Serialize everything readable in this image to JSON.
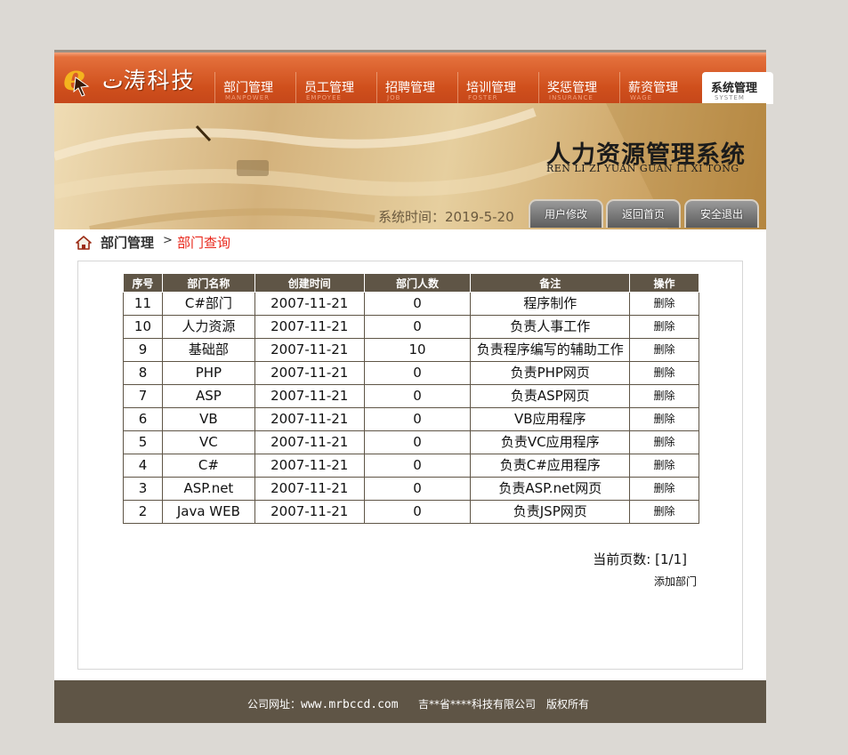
{
  "brand": {
    "name": "ت涛科技"
  },
  "nav": [
    {
      "cn": "部门管理",
      "en": "MANPOWER"
    },
    {
      "cn": "员工管理",
      "en": "EMPOYEE"
    },
    {
      "cn": "招聘管理",
      "en": "JOB"
    },
    {
      "cn": "培训管理",
      "en": "FOSTER"
    },
    {
      "cn": "奖惩管理",
      "en": "INSURANCE"
    },
    {
      "cn": "薪资管理",
      "en": "WAGE"
    },
    {
      "cn": "系统管理",
      "en": "SYSTEM"
    }
  ],
  "banner": {
    "title": "人力资源管理系统",
    "pinyin": "REN LI ZI YUAN GUAN LI XI TONG",
    "time_label": "系统时间：",
    "time_value": "2019-5-20",
    "buttons": [
      "用户修改",
      "返回首页",
      "安全退出"
    ]
  },
  "breadcrumb": {
    "section": "部门管理",
    "separator": ">",
    "page": "部门查询"
  },
  "table": {
    "headers": [
      "序号",
      "部门名称",
      "创建时间",
      "部门人数",
      "备注",
      "操作"
    ],
    "rows": [
      [
        "11",
        "C#部门",
        "2007-11-21",
        "0",
        "程序制作",
        "删除"
      ],
      [
        "10",
        "人力资源",
        "2007-11-21",
        "0",
        "负责人事工作",
        "删除"
      ],
      [
        "9",
        "基础部",
        "2007-11-21",
        "10",
        "负责程序编写的辅助工作",
        "删除"
      ],
      [
        "8",
        "PHP",
        "2007-11-21",
        "0",
        "负责PHP网页",
        "删除"
      ],
      [
        "7",
        "ASP",
        "2007-11-21",
        "0",
        "负责ASP网页",
        "删除"
      ],
      [
        "6",
        "VB",
        "2007-11-21",
        "0",
        "VB应用程序",
        "删除"
      ],
      [
        "5",
        "VC",
        "2007-11-21",
        "0",
        "负责VC应用程序",
        "删除"
      ],
      [
        "4",
        "C#",
        "2007-11-21",
        "0",
        "负责C#应用程序",
        "删除"
      ],
      [
        "3",
        "ASP.net",
        "2007-11-21",
        "0",
        "负责ASP.net网页",
        "删除"
      ],
      [
        "2",
        "Java WEB",
        "2007-11-21",
        "0",
        "负责JSP网页",
        "删除"
      ]
    ]
  },
  "pager": {
    "label": "当前页数:",
    "value": "[1/1]"
  },
  "actions": {
    "add": "添加部门"
  },
  "footer": {
    "url_label": "公司网址：",
    "url": "www.mrbccd.com",
    "company": "吉**省****科技有限公司",
    "rights": "版权所有"
  },
  "colors": {
    "header_orange": "#cf4f1c",
    "table_header": "#5f5546",
    "crumb_active": "#e8261a"
  }
}
